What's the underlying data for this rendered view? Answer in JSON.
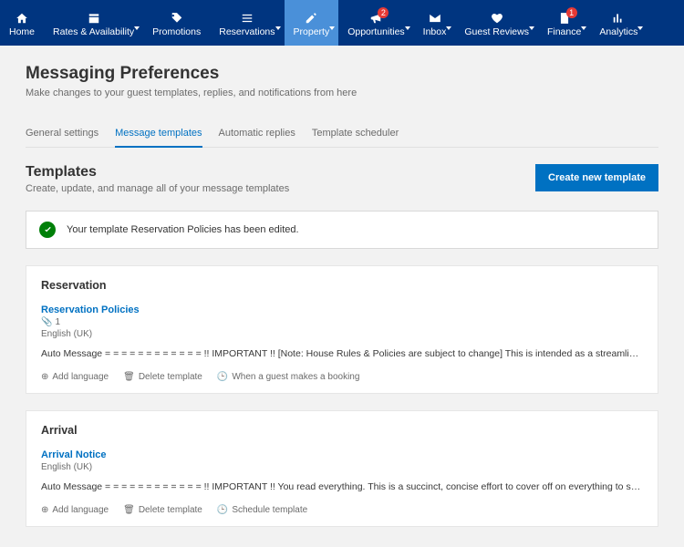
{
  "nav": {
    "items": [
      {
        "label": "Home"
      },
      {
        "label": "Rates & Availability"
      },
      {
        "label": "Promotions"
      },
      {
        "label": "Reservations"
      },
      {
        "label": "Property"
      },
      {
        "label": "Opportunities",
        "badge": "2"
      },
      {
        "label": "Inbox"
      },
      {
        "label": "Guest Reviews"
      },
      {
        "label": "Finance",
        "badge": "1"
      },
      {
        "label": "Analytics"
      }
    ]
  },
  "page": {
    "title": "Messaging Preferences",
    "subtitle": "Make changes to your guest templates, replies, and notifications from here"
  },
  "tabs": [
    {
      "label": "General settings"
    },
    {
      "label": "Message templates"
    },
    {
      "label": "Automatic replies"
    },
    {
      "label": "Template scheduler"
    }
  ],
  "templates_section": {
    "title": "Templates",
    "subtitle": "Create, update, and manage all of your message templates",
    "create_button": "Create new template"
  },
  "alert": {
    "text": "Your template Reservation Policies has been edited."
  },
  "cards": [
    {
      "category": "Reservation",
      "template_title": "Reservation Policies",
      "attach_count": "1",
      "language": "English (UK)",
      "body": "Auto Message = = = = = = = = = = = = !! IMPORTANT !! [Note: House Rules & Policies are subject to change] This is intended as a streamlined concise collection of related inf…",
      "actions": {
        "add_lang": "Add language",
        "delete": "Delete template",
        "schedule": "When a guest makes a booking"
      }
    },
    {
      "category": "Arrival",
      "template_title": "Arrival Notice",
      "language": "English (UK)",
      "body": "Auto Message = = = = = = = = = = = = !! IMPORTANT !! You read everything. This is a succinct, concise effort to cover off on everything to streamline your stay. ------------ …",
      "actions": {
        "add_lang": "Add language",
        "delete": "Delete template",
        "schedule": "Schedule template"
      }
    }
  ]
}
